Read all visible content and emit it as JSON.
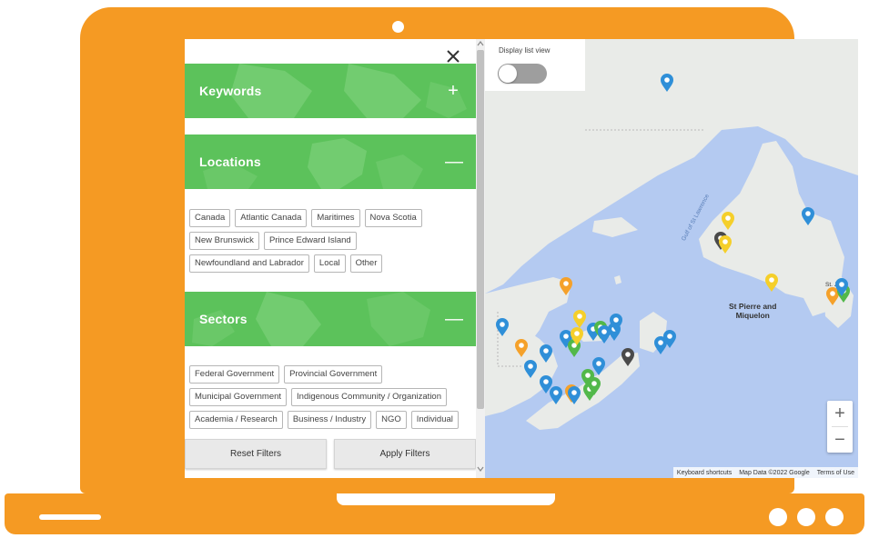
{
  "panel": {
    "sections": {
      "keywords": {
        "title": "Keywords",
        "sign": "+"
      },
      "locations": {
        "title": "Locations",
        "sign": "—"
      },
      "sectors": {
        "title": "Sectors",
        "sign": "—"
      }
    },
    "location_tags": [
      "Canada",
      "Atlantic Canada",
      "Maritimes",
      "Nova Scotia",
      "New Brunswick",
      "Prince Edward Island",
      "Newfoundland and Labrador",
      "Local",
      "Other"
    ],
    "sector_tags": [
      "Federal Government",
      "Provincial Government",
      "Municipal Government",
      "Indigenous Community / Organization",
      "Academia / Research",
      "Business / Industry",
      "NGO",
      "Individual"
    ],
    "reset_label": "Reset Filters",
    "apply_label": "Apply Filters"
  },
  "map": {
    "list_view_label": "Display list view",
    "list_view_on": false,
    "zoom_in": "+",
    "zoom_out": "−",
    "labels": {
      "st_pierre": "St Pierre and\nMiquelon",
      "gulf": "Gulf of St Lawrence",
      "st_johns": "St. J's"
    },
    "attribution": [
      "Keyboard shortcuts",
      "Map Data ©2022 Google",
      "Terms of Use"
    ],
    "marker_colors": {
      "blue": "#2f8fd8",
      "yellow": "#f5cf2a",
      "orange": "#f5a12a",
      "green": "#52b84a",
      "dark": "#4a4a4a"
    }
  },
  "colors": {
    "laptop": "#f59a23",
    "section_green": "#5cc25b",
    "water": "#b4caf1",
    "land": "#e9ebe8"
  }
}
